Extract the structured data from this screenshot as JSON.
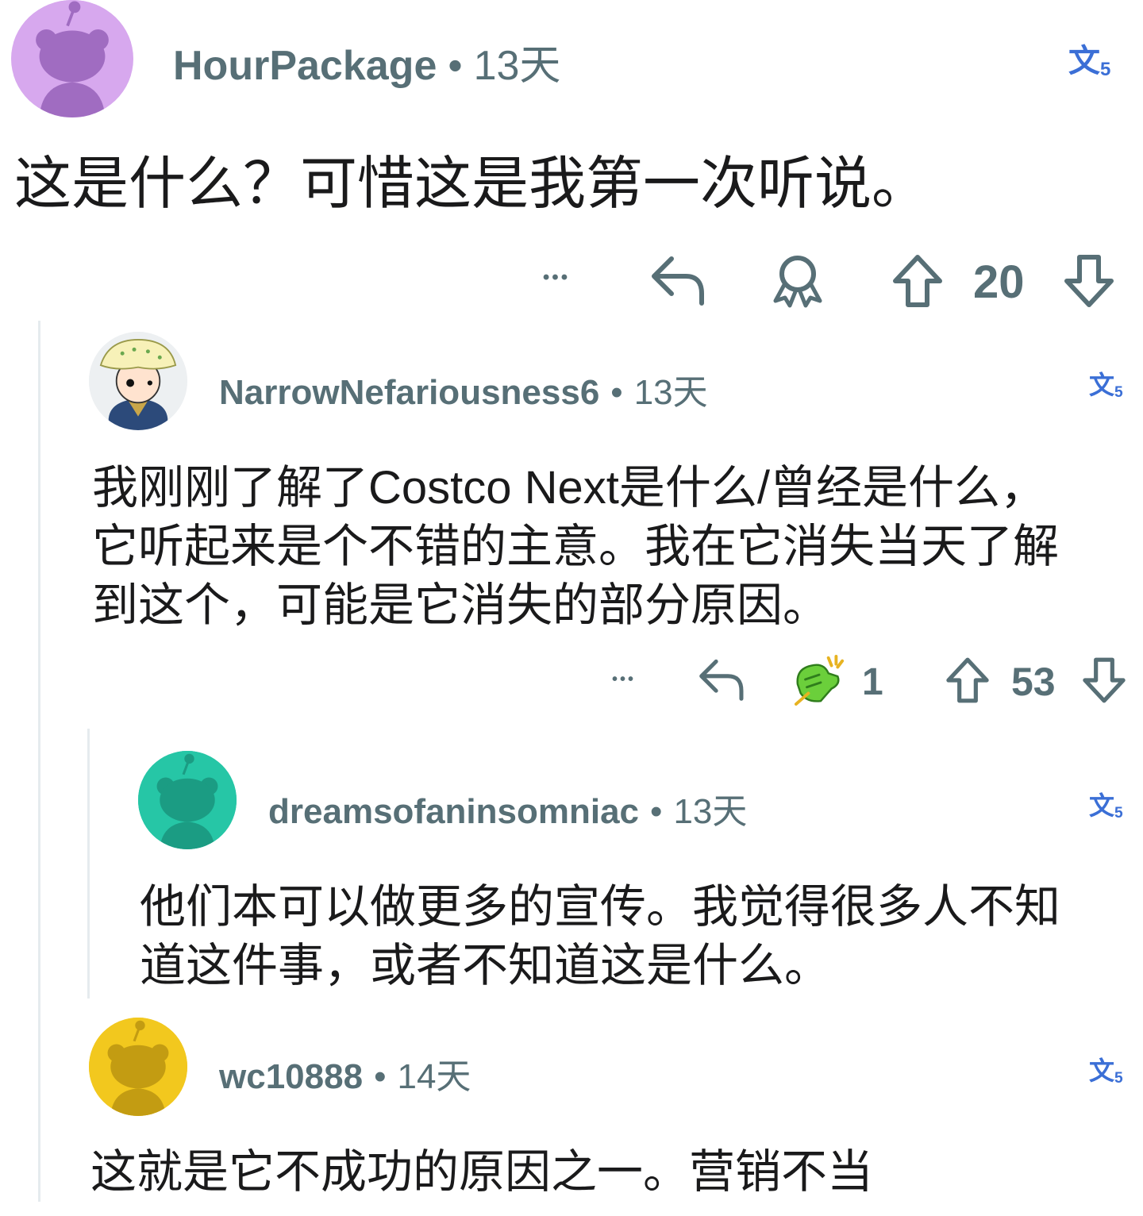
{
  "comments": [
    {
      "username": "HourPackage",
      "separator": "•",
      "time": "13天",
      "translate_label": "文",
      "translate_sub": "5",
      "body": "这是什么？可惜这是我第一次听说。",
      "more_label": "•••",
      "vote_count": "20",
      "avatar_color": "#d7a8ee",
      "avatar_fg": "#a06cc1"
    },
    {
      "username": "NarrowNefariousness6",
      "separator": "•",
      "time": "13天",
      "translate_label": "文",
      "translate_sub": "5",
      "body_lines": [
        "我刚刚了解了Costco Next是什么/曾经是什么，",
        "它听起来是个不错的主意。我在它消失当天了解",
        "到这个，可能是它消失的部分原因。"
      ],
      "more_label": "•••",
      "award_count": "1",
      "vote_count": "53"
    },
    {
      "username": "dreamsofaninsomniac",
      "separator": "•",
      "time": "13天",
      "translate_label": "文",
      "translate_sub": "5",
      "body_lines": [
        "他们本可以做更多的宣传。我觉得很多人不知",
        "道这件事，或者不知道这是什么。"
      ],
      "avatar_color": "#26c6a6",
      "avatar_fg": "#1b9c83"
    },
    {
      "username": "wc10888",
      "separator": "•",
      "time": "14天",
      "translate_label": "文",
      "translate_sub": "5",
      "body": "这就是它不成功的原因之一。营销不当",
      "avatar_color": "#f2c81e",
      "avatar_fg": "#c39c12"
    }
  ]
}
